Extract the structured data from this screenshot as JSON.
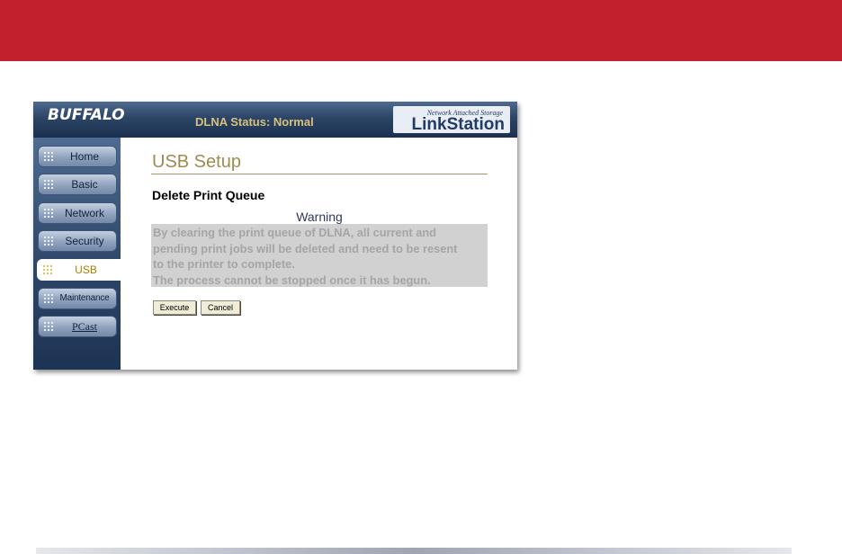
{
  "header": {
    "brand": "BUFFALO",
    "status": "DLNA Status: Normal",
    "product_tagline": "Network Attached Storage",
    "product_name": "LinkStation"
  },
  "sidebar": {
    "items": [
      {
        "label": "Home"
      },
      {
        "label": "Basic"
      },
      {
        "label": "Network"
      },
      {
        "label": "Security"
      },
      {
        "label": "USB",
        "active": true
      },
      {
        "label": "Maintenance"
      },
      {
        "label": "PCast"
      }
    ]
  },
  "main": {
    "title": "USB Setup",
    "section_title": "Delete Print Queue",
    "warning_title": "Warning",
    "warning_lines": [
      "By clearing the print queue of DLNA, all current and",
      "pending print jobs will be deleted and need to be resent",
      "to the printer to complete.",
      "The process cannot be stopped once it has begun."
    ],
    "execute_label": "Execute",
    "cancel_label": "Cancel"
  },
  "colors": {
    "band": "#c3202e",
    "title": "#a08a4f",
    "status": "#d7c17e",
    "active_nav": "#b07a00"
  }
}
